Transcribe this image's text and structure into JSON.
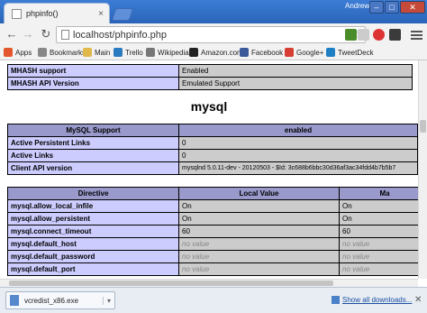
{
  "window": {
    "tab_title": "phpinfo()",
    "tab_close": "×",
    "user": "Andrew",
    "minimize": "–",
    "maximize": "□",
    "close": "✕"
  },
  "toolbar": {
    "back": "←",
    "forward": "→",
    "reload": "↻",
    "url": "localhost/phpinfo.php",
    "star": "☆"
  },
  "bookmarks": [
    {
      "label": "Apps",
      "icon": "apps-icon",
      "color": "#e4572e"
    },
    {
      "label": "Bookmarks",
      "icon": "star-icon",
      "color": "#888888"
    },
    {
      "label": "Main",
      "icon": "folder-icon",
      "color": "#e1b84a"
    },
    {
      "label": "Trello",
      "icon": "trello-icon",
      "color": "#2b7bc0"
    },
    {
      "label": "Wikipedia",
      "icon": "wikipedia-icon",
      "color": "#777777"
    },
    {
      "label": "Amazon.com",
      "icon": "amazon-icon",
      "color": "#222222"
    },
    {
      "label": "Facebook",
      "icon": "facebook-icon",
      "color": "#3b5998"
    },
    {
      "label": "Google+",
      "icon": "google-plus-icon",
      "color": "#d73d32"
    },
    {
      "label": "TweetDeck",
      "icon": "tweetdeck-icon",
      "color": "#1f7fc5"
    }
  ],
  "mhash_table": [
    {
      "name": "MHASH support",
      "value": "Enabled"
    },
    {
      "name": "MHASH API Version",
      "value": "Emulated Support"
    }
  ],
  "section_title": "mysql",
  "mysql_table": {
    "header": [
      "MySQL Support",
      "enabled"
    ],
    "rows": [
      {
        "name": "Active Persistent Links",
        "value": "0"
      },
      {
        "name": "Active Links",
        "value": "0"
      },
      {
        "name": "Client API version",
        "value": "mysqlnd 5.0.11-dev - 20120503 - $Id: 3c688b6bbc30d36af3ac34fdd4b7b5b7"
      }
    ]
  },
  "directive_table": {
    "header": [
      "Directive",
      "Local Value",
      "Ma"
    ],
    "rows": [
      {
        "name": "mysql.allow_local_infile",
        "local": "On",
        "master": "On"
      },
      {
        "name": "mysql.allow_persistent",
        "local": "On",
        "master": "On"
      },
      {
        "name": "mysql.connect_timeout",
        "local": "60",
        "master": "60"
      },
      {
        "name": "mysql.default_host",
        "local": "no value",
        "master": "no value"
      },
      {
        "name": "mysql.default_password",
        "local": "no value",
        "master": "no value"
      },
      {
        "name": "mysql.default_port",
        "local": "no value",
        "master": "no value"
      }
    ]
  },
  "downloads": {
    "file_name": "vcredist_x86.exe",
    "chevron": "▾",
    "show_all": "Show all downloads...",
    "close": "✕"
  }
}
